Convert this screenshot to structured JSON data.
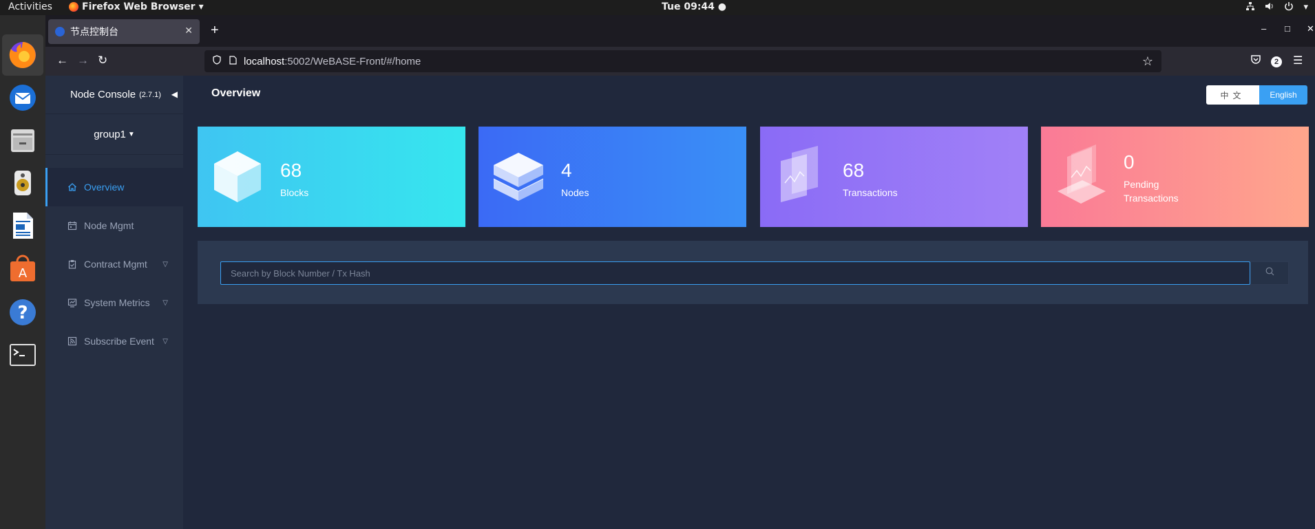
{
  "system": {
    "activities": "Activities",
    "app_name": "Firefox Web Browser",
    "clock": "Tue 09:44 ●"
  },
  "browser": {
    "tab_title": "节点控制台",
    "url_host": "localhost",
    "url_rest": ":5002/WeBASE-Front/#/home",
    "pocket_count": "2"
  },
  "sidebar": {
    "title": "Node Console",
    "version": "(2.7.1)",
    "group": "group1",
    "items": [
      {
        "label": "Overview",
        "active": true
      },
      {
        "label": "Node Mgmt",
        "active": false
      },
      {
        "label": "Contract Mgmt",
        "active": false
      },
      {
        "label": "System Metrics",
        "active": false
      },
      {
        "label": "Subscribe Event",
        "active": false
      }
    ]
  },
  "header": {
    "title": "Overview",
    "lang_zh": "中文",
    "lang_en": "English"
  },
  "stats": [
    {
      "value": "68",
      "label": "Blocks"
    },
    {
      "value": "4",
      "label": "Nodes"
    },
    {
      "value": "68",
      "label": "Transactions"
    },
    {
      "value": "0",
      "label": "Pending Transactions"
    }
  ],
  "search": {
    "placeholder": "Search by Block Number / Tx Hash"
  },
  "colors": {
    "accent": "#3aa0f3",
    "background": "#20283c",
    "sidebar": "#262f42"
  }
}
